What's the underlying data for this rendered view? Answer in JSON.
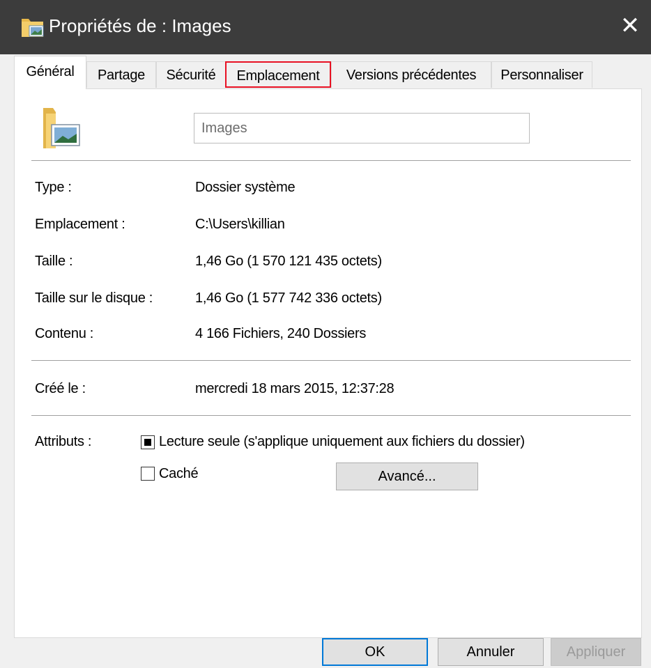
{
  "window": {
    "title": "Propriétés de : Images",
    "close_glyph": "✕"
  },
  "tabs": [
    {
      "label": "Général",
      "active": true
    },
    {
      "label": "Partage"
    },
    {
      "label": "Sécurité"
    },
    {
      "label": "Emplacement",
      "highlighted": true
    },
    {
      "label": "Versions précédentes"
    },
    {
      "label": "Personnaliser"
    }
  ],
  "general": {
    "folder_name": "Images",
    "icon": "pictures-folder-icon",
    "properties": [
      {
        "label": "Type :",
        "value": "Dossier système"
      },
      {
        "label": "Emplacement :",
        "value": "C:\\Users\\killian"
      },
      {
        "label": "Taille :",
        "value": "1,46 Go (1 570 121 435 octets)"
      },
      {
        "label": "Taille sur le disque :",
        "value": "1,46 Go (1 577 742 336 octets)"
      },
      {
        "label": "Contenu :",
        "value": "4 166 Fichiers, 240 Dossiers"
      }
    ],
    "created": {
      "label": "Créé le :",
      "value": "mercredi 18 mars 2015, 12:37:28"
    },
    "attributes": {
      "label": "Attributs :",
      "readonly": {
        "label": "Lecture seule (s'applique uniquement aux fichiers du dossier)",
        "state": "indeterminate"
      },
      "hidden": {
        "label": "Caché",
        "state": "unchecked"
      },
      "advanced_button": "Avancé..."
    }
  },
  "buttons": {
    "ok": "OK",
    "cancel": "Annuler",
    "apply": "Appliquer"
  },
  "colors": {
    "titlebar": "#3c3c3c",
    "highlight": "#e81123",
    "default_button_border": "#0078d7"
  }
}
